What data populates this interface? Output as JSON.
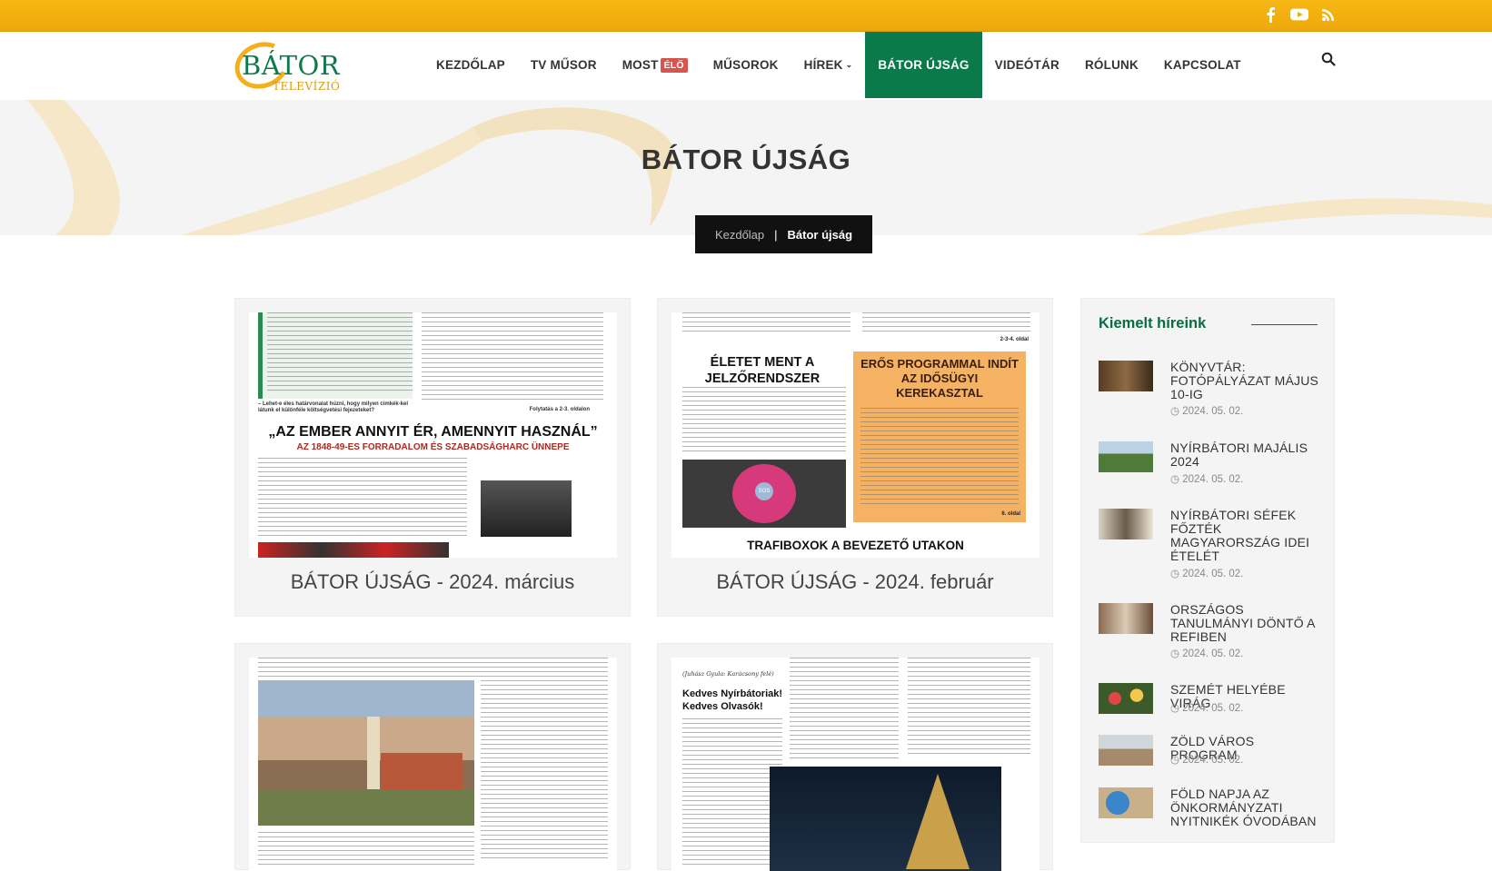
{
  "social": {
    "icons": [
      "facebook-icon",
      "youtube-icon",
      "rss-icon"
    ]
  },
  "logo": {
    "name": "BÁTOR",
    "sub": "TELEVÍZIÓ"
  },
  "menu": {
    "items": [
      {
        "label": "KEZDŐLAP"
      },
      {
        "label": "TV MŰSOR"
      },
      {
        "label": "MOST",
        "badge": "ÉLŐ"
      },
      {
        "label": "MŰSOROK"
      },
      {
        "label": "HÍREK"
      },
      {
        "label": "BÁTOR ÚJSÁG",
        "active": true
      },
      {
        "label": "VIDEÓTÁR"
      },
      {
        "label": "RÓLUNK"
      },
      {
        "label": "KAPCSOLAT"
      }
    ]
  },
  "page": {
    "title": "BÁTOR ÚJSÁG",
    "breadcrumb": {
      "home": "Kezdőlap",
      "sep": "|",
      "current": "Bátor újság"
    }
  },
  "cards": [
    {
      "title": "BÁTOR ÚJSÁG - 2024. március",
      "headline": "„AZ EMBER ANNYIT ÉR, AMENNYIT HASZNÁL”",
      "subheadline": "AZ 1848-49-ES FORRADALOM ÉS SZABADSÁGHARC ÜNNEPE",
      "top_question": "– Lehet-e éles határvonalat húzni, hogy milyen címkék-kel látunk el különféle költségvetési fejezeteket?",
      "continue": "Folytatás a 2-3. oldalon"
    },
    {
      "title": "BÁTOR ÚJSÁG - 2024. február",
      "headline_left": "ÉLETET MENT A JELZŐRENDSZER",
      "headline_right": "ERŐS PROGRAMMAL INDÍT AZ IDŐSÜGYI KEREKASZTAL",
      "badge_text": "SOS",
      "bottom_headline": "TRAFIBOXOK A BEVEZETŐ UTAKON",
      "page_ref_1": "2-3-4. oldal",
      "page_ref_2": "6. oldal"
    },
    {
      "title": ""
    },
    {
      "title": "",
      "greeting_1": "Kedves Nyírbátoriak!",
      "greeting_2": "Kedves Olvasók!",
      "quote_author": "(Juhász Gyula: Karácsony felé)"
    }
  ],
  "sidebar": {
    "title": "Kiemelt híreink",
    "news": [
      {
        "title": "KÖNYVTÁR: FOTÓPÁLYÁZAT MÁJUS 10-IG",
        "date": "2024. 05. 02."
      },
      {
        "title": "NYÍRBÁTORI MAJÁLIS 2024",
        "date": "2024. 05. 02."
      },
      {
        "title": "NYÍRBÁTORI SÉFEK FŐZTÉK MAGYARORSZÁG IDEI ÉTELÉT",
        "date": "2024. 05. 02."
      },
      {
        "title": "ORSZÁGOS TANULMÁNYI DÖNTŐ A REFIBEN",
        "date": "2024. 05. 02."
      },
      {
        "title": "SZEMÉT HELYÉBE VIRÁG",
        "date": "2024. 05. 02."
      },
      {
        "title": "ZÖLD VÁROS PROGRAM",
        "date": "2024. 05. 02."
      },
      {
        "title": "FÖLD NAPJA AZ ÖNKORMÁNYZATI NYITNIKÉK ÓVODÁBAN",
        "date": ""
      }
    ]
  },
  "colors": {
    "topbar": "#f2b211",
    "brand_green": "#0b7a4b",
    "live_red": "#d9534f"
  }
}
